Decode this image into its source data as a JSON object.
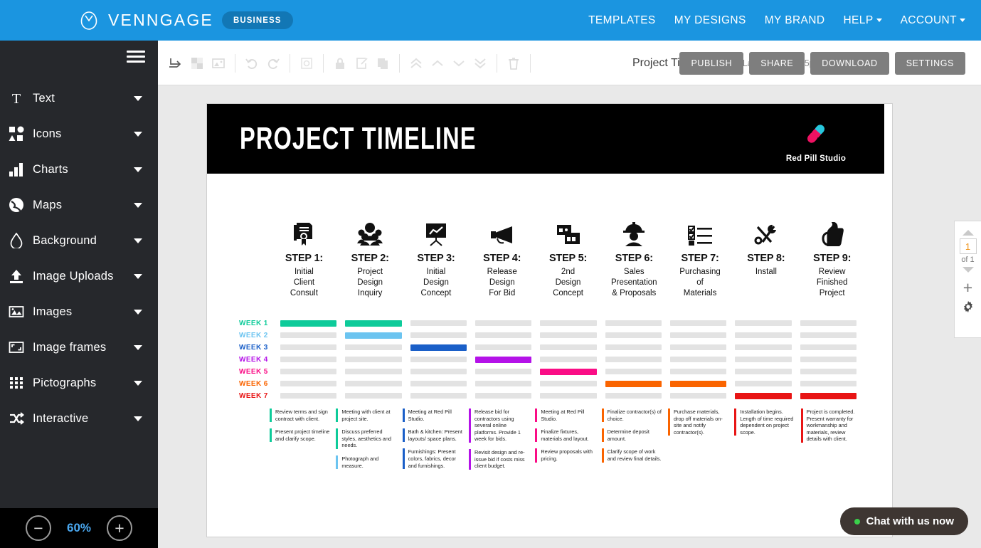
{
  "topnav": {
    "brand": "VENNGAGE",
    "badge": "BUSINESS",
    "logo_icon": "venn-circle-icon",
    "links": [
      {
        "label": "TEMPLATES",
        "caret": false
      },
      {
        "label": "MY DESIGNS",
        "caret": false
      },
      {
        "label": "MY BRAND",
        "caret": false
      },
      {
        "label": "HELP",
        "caret": true
      },
      {
        "label": "ACCOUNT",
        "caret": true
      }
    ]
  },
  "sidebar": {
    "menu_icon": "hamburger-icon",
    "items": [
      {
        "label": "Text",
        "icon": "text-icon"
      },
      {
        "label": "Icons",
        "icon": "shapes-icon"
      },
      {
        "label": "Charts",
        "icon": "bar-chart-icon"
      },
      {
        "label": "Maps",
        "icon": "globe-icon"
      },
      {
        "label": "Background",
        "icon": "droplet-icon"
      },
      {
        "label": "Image Uploads",
        "icon": "upload-icon"
      },
      {
        "label": "Images",
        "icon": "picture-icon"
      },
      {
        "label": "Image frames",
        "icon": "frame-icon"
      },
      {
        "label": "Pictographs",
        "icon": "grid-dots-icon"
      },
      {
        "label": "Interactive",
        "icon": "shuffle-icon"
      }
    ],
    "zoom": {
      "minus": "−",
      "value": "60%",
      "plus": "+"
    }
  },
  "toolbar": {
    "tools": [
      {
        "name": "align-icon"
      },
      {
        "name": "background-color-icon"
      },
      {
        "name": "image-icon"
      },
      {
        "name": "undo-icon"
      },
      {
        "name": "redo-icon"
      },
      {
        "name": "crop-icon"
      },
      {
        "name": "lock-icon"
      },
      {
        "name": "edit-icon"
      },
      {
        "name": "duplicate-icon"
      },
      {
        "name": "bring-to-front-icon"
      },
      {
        "name": "bring-forward-icon"
      },
      {
        "name": "send-backward-icon"
      },
      {
        "name": "send-to-back-icon"
      },
      {
        "name": "delete-icon"
      }
    ],
    "doc_title": "Project Timeline",
    "rename_icon": "pencil-square-icon",
    "last_saved": "Last Saved: 4:15pm",
    "actions": [
      "PUBLISH",
      "SHARE",
      "DOWNLOAD",
      "SETTINGS"
    ]
  },
  "pagenav": {
    "up_icon": "chevron-up-icon",
    "page_number": "1",
    "of_label": "of 1",
    "down_icon": "chevron-down-icon",
    "add_page_icon": "plus-icon",
    "settings_icon": "gear-icon"
  },
  "chat": {
    "label": "Chat with us now",
    "status_icon": "online-dot-icon"
  },
  "design": {
    "banner_title": "PROJECT TIMELINE",
    "studio_name": "Red Pill Studio",
    "studio_logo_icon": "pill-capsule-icon",
    "steps": [
      {
        "num": "STEP 1:",
        "desc": "Initial\nClient\nConsult",
        "icon": "certificate-icon"
      },
      {
        "num": "STEP 2:",
        "desc": "Project\nDesign\nInquiry",
        "icon": "people-group-icon"
      },
      {
        "num": "STEP 3:",
        "desc": "Initial\nDesign\nConcept",
        "icon": "presentation-chart-icon"
      },
      {
        "num": "STEP 4:",
        "desc": "Release\nDesign\nFor Bid",
        "icon": "megaphone-icon"
      },
      {
        "num": "STEP 5:",
        "desc": "2nd\nDesign\nConcept",
        "icon": "layout-windows-icon"
      },
      {
        "num": "STEP 6:",
        "desc": "Sales\nPresentation\n& Proposals",
        "icon": "construction-worker-icon"
      },
      {
        "num": "STEP 7:",
        "desc": "Purchasing\nof\nMaterials",
        "icon": "checklist-icon"
      },
      {
        "num": "STEP 8:",
        "desc": "Install",
        "icon": "tools-icon"
      },
      {
        "num": "STEP 9:",
        "desc": "Review\nFinished\nProject",
        "icon": "thumbs-up-icon"
      }
    ],
    "chart_data": {
      "type": "bar",
      "title": "PROJECT TIMELINE",
      "xlabel": "",
      "ylabel": "",
      "grid": false,
      "legend": "none",
      "categories": [
        "WEEK 1",
        "WEEK 2",
        "WEEK 3",
        "WEEK 4",
        "WEEK 5",
        "WEEK 6",
        "WEEK 7"
      ],
      "series_axis": [
        "STEP 1",
        "STEP 2",
        "STEP 3",
        "STEP 4",
        "STEP 5",
        "STEP 6",
        "STEP 7",
        "STEP 8",
        "STEP 9"
      ],
      "week_colors": [
        "#0ecb9a",
        "#6cc4f0",
        "#1a5fc8",
        "#b412e8",
        "#fa0d86",
        "#fa6400",
        "#e81515"
      ],
      "inactive_color": "#e3e3e3",
      "active_cells": [
        {
          "week": "WEEK 1",
          "steps": [
            "STEP 1",
            "STEP 2"
          ],
          "color": "#0ecb9a"
        },
        {
          "week": "WEEK 2",
          "steps": [
            "STEP 2"
          ],
          "color": "#6cc4f0"
        },
        {
          "week": "WEEK 3",
          "steps": [
            "STEP 3"
          ],
          "color": "#1a5fc8"
        },
        {
          "week": "WEEK 4",
          "steps": [
            "STEP 4"
          ],
          "color": "#b412e8"
        },
        {
          "week": "WEEK 5",
          "steps": [
            "STEP 5"
          ],
          "color": "#fa0d86"
        },
        {
          "week": "WEEK 6",
          "steps": [
            "STEP 6",
            "STEP 7"
          ],
          "color": "#fa6400"
        },
        {
          "week": "WEEK 7",
          "steps": [
            "STEP 8",
            "STEP 9"
          ],
          "color": "#e81515"
        }
      ],
      "matrix": [
        [
          1,
          1,
          0,
          0,
          0,
          0,
          0,
          0,
          0
        ],
        [
          0,
          1,
          0,
          0,
          0,
          0,
          0,
          0,
          0
        ],
        [
          0,
          0,
          1,
          0,
          0,
          0,
          0,
          0,
          0
        ],
        [
          0,
          0,
          0,
          1,
          0,
          0,
          0,
          0,
          0
        ],
        [
          0,
          0,
          0,
          0,
          1,
          0,
          0,
          0,
          0
        ],
        [
          0,
          0,
          0,
          0,
          0,
          1,
          1,
          0,
          0
        ],
        [
          0,
          0,
          0,
          0,
          0,
          0,
          0,
          1,
          1
        ]
      ]
    },
    "note_columns": [
      {
        "color": "#0ecb9a",
        "notes": [
          {
            "color": "#0ecb9a",
            "text": "Review terms and sign contract with client."
          },
          {
            "color": "#0ecb9a",
            "text": "Present project timeline and clarify scope."
          }
        ]
      },
      {
        "color": "#0ecb9a",
        "notes": [
          {
            "color": "#0ecb9a",
            "text": "Meeting with client at project site."
          },
          {
            "color": "#0ecb9a",
            "text": "Discuss preferred styles, aesthetics and needs."
          },
          {
            "color": "#6cc4f0",
            "text": "Photograph and measure."
          }
        ]
      },
      {
        "color": "#1a5fc8",
        "notes": [
          {
            "color": "#1a5fc8",
            "text": "Meeting at Red Pill Studio."
          },
          {
            "color": "#1a5fc8",
            "text": "Bath & kitchen: Present layouts/ space plans."
          },
          {
            "color": "#1a5fc8",
            "text": "Furnishings: Present colors, fabrics, decor and furnishings."
          }
        ]
      },
      {
        "color": "#b412e8",
        "notes": [
          {
            "color": "#b412e8",
            "text": "Release bid for contractors using several online platforms. Provide 1 week for bids."
          },
          {
            "color": "#b412e8",
            "text": "Revisit design and re-issue bid if costs miss client budget."
          }
        ]
      },
      {
        "color": "#fa0d86",
        "notes": [
          {
            "color": "#fa0d86",
            "text": "Meeting at Red Pill Studio."
          },
          {
            "color": "#fa0d86",
            "text": "Finalize fixtures, materials and layout."
          },
          {
            "color": "#fa0d86",
            "text": "Review proposals with pricing."
          }
        ]
      },
      {
        "color": "#fa6400",
        "notes": [
          {
            "color": "#fa6400",
            "text": "Finalize contractor(s) of choice."
          },
          {
            "color": "#fa6400",
            "text": "Determine deposit amount."
          },
          {
            "color": "#fa6400",
            "text": "Clarify scope of work and review final details."
          }
        ]
      },
      {
        "color": "#fa6400",
        "notes": [
          {
            "color": "#fa6400",
            "text": "Purchase materials, drop off materials on-site and notify contractor(s)."
          }
        ]
      },
      {
        "color": "#e81515",
        "notes": [
          {
            "color": "#e81515",
            "text": "Installation begins. Length of time required dependent on project scope."
          }
        ]
      },
      {
        "color": "#e81515",
        "notes": [
          {
            "color": "#e81515",
            "text": "Project is completed. Present warranty for workmanship and materials, review details with client."
          }
        ]
      }
    ]
  }
}
